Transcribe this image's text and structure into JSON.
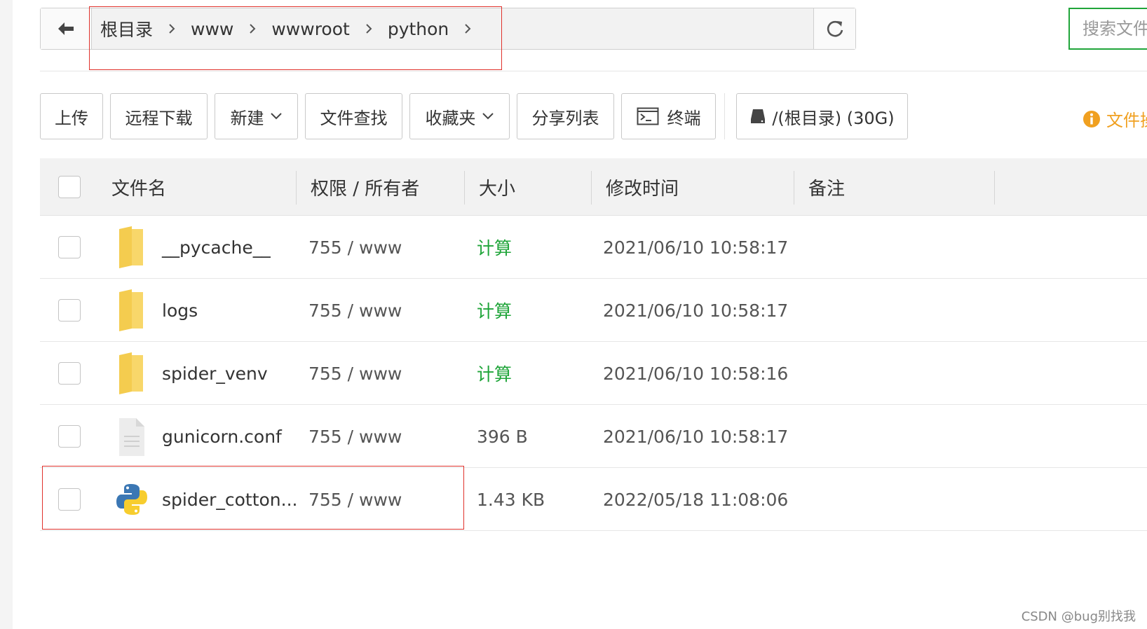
{
  "breadcrumb": {
    "items": [
      "根目录",
      "www",
      "wwwroot",
      "python"
    ]
  },
  "search": {
    "placeholder": "搜索文件"
  },
  "toolbar": {
    "upload": "上传",
    "remote_download": "远程下载",
    "new": "新建",
    "file_search": "文件查找",
    "favorites": "收藏夹",
    "share_list": "分享列表",
    "terminal": "终端",
    "disk": "/(根目录) (30G)"
  },
  "tip": {
    "label": "文件操"
  },
  "table": {
    "headers": {
      "name": "文件名",
      "permission": "权限 / 所有者",
      "size": "大小",
      "modified": "修改时间",
      "remark": "备注"
    },
    "rows": [
      {
        "name": "__pycache__",
        "type": "folder",
        "permission": "755 / www",
        "size": "计算",
        "size_is_link": true,
        "modified": "2021/06/10 10:58:17"
      },
      {
        "name": "logs",
        "type": "folder",
        "permission": "755 / www",
        "size": "计算",
        "size_is_link": true,
        "modified": "2021/06/10 10:58:17"
      },
      {
        "name": "spider_venv",
        "type": "folder",
        "permission": "755 / www",
        "size": "计算",
        "size_is_link": true,
        "modified": "2021/06/10 10:58:16"
      },
      {
        "name": "gunicorn.conf",
        "type": "text-file",
        "permission": "755 / www",
        "size": "396 B",
        "size_is_link": false,
        "modified": "2021/06/10 10:58:17"
      },
      {
        "name": "spider_cotton...",
        "type": "python-file",
        "permission": "755 / www",
        "size": "1.43 KB",
        "size_is_link": false,
        "modified": "2022/05/18 11:08:06"
      }
    ]
  },
  "watermark": "CSDN @bug别找我",
  "colors": {
    "accent_green": "#20a53a",
    "tip_orange": "#f0a020",
    "highlight_red": "#e0322c"
  },
  "icons": {
    "back": "arrow-left-icon",
    "refresh": "refresh-icon",
    "crumb_sep": "chevron-right-icon",
    "dropdown": "chevron-down-icon",
    "terminal": "terminal-icon",
    "disk": "hard-drive-icon",
    "info": "info-icon",
    "folder": "folder-icon",
    "text_file": "text-file-icon",
    "python_file": "python-file-icon"
  }
}
